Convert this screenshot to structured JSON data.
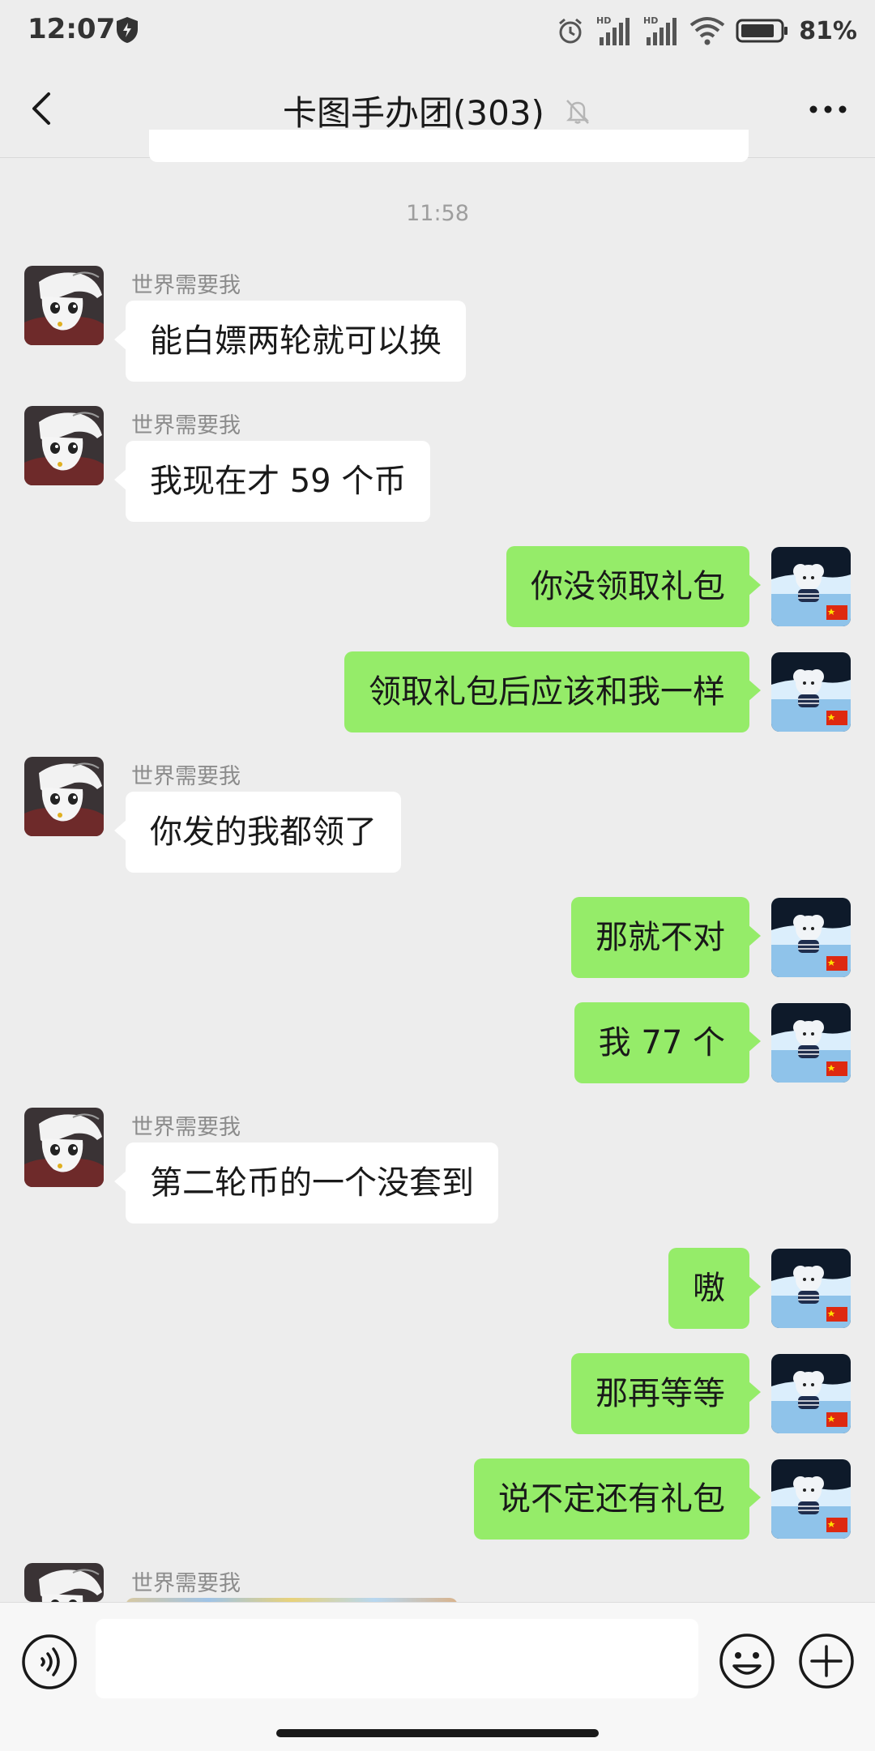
{
  "status_bar": {
    "time": "12:07",
    "battery_percent": "81%",
    "icons": [
      "shield-icon",
      "alarm-icon",
      "hd-signal-icon",
      "hd-signal-icon",
      "wifi-icon",
      "battery-icon"
    ]
  },
  "header": {
    "title": "卡图手办团(303)",
    "icons": [
      "back-arrow-icon",
      "mute-bell-icon",
      "more-dots-icon"
    ]
  },
  "chat": {
    "timestamp": "11:58",
    "messages": [
      {
        "side": "in",
        "sender": "世界需要我",
        "text": "能白嫖两轮就可以换"
      },
      {
        "side": "in",
        "sender": "世界需要我",
        "text": "我现在才 59 个币"
      },
      {
        "side": "out",
        "text": "你没领取礼包"
      },
      {
        "side": "out",
        "text": "领取礼包后应该和我一样"
      },
      {
        "side": "in",
        "sender": "世界需要我",
        "text": "你发的我都领了"
      },
      {
        "side": "out",
        "text": "那就不对"
      },
      {
        "side": "out",
        "text": "我 77 个"
      },
      {
        "side": "in",
        "sender": "世界需要我",
        "text": "第二轮币的一个没套到"
      },
      {
        "side": "out",
        "text": "嗷"
      },
      {
        "side": "out",
        "text": "那再等等"
      },
      {
        "side": "out",
        "text": "说不定还有礼包"
      },
      {
        "side": "in",
        "sender": "世界需要我",
        "text": ""
      }
    ]
  },
  "input_bar": {
    "placeholder": "",
    "icons": [
      "voice-icon",
      "emoji-icon",
      "plus-icon"
    ]
  },
  "colors": {
    "background": "#ededed",
    "outgoing_bubble": "#95ec69",
    "incoming_bubble": "#ffffff",
    "input_bar": "#f7f7f7"
  }
}
